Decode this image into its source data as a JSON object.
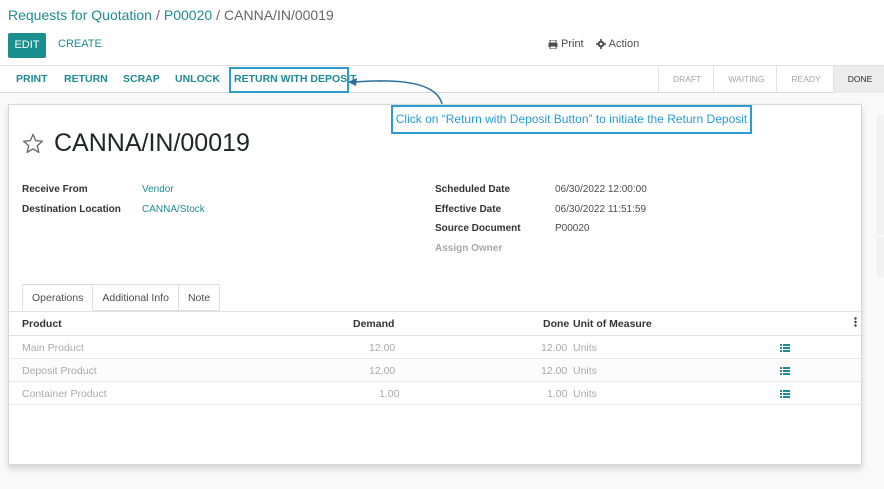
{
  "breadcrumb": {
    "crumb1": "Requests for Quotation",
    "crumb2": "P00020",
    "current": "CANNA/IN/00019",
    "separator": "/"
  },
  "control": {
    "edit_label": "EDIT",
    "create_label": "CREATE",
    "print_label": "Print",
    "action_label": "Action"
  },
  "statusbar": {
    "buttons": [
      "PRINT",
      "RETURN",
      "SCRAP",
      "UNLOCK",
      "RETURN WITH DEPOSIT"
    ],
    "stages": [
      "DRAFT",
      "WAITING",
      "READY",
      "DONE"
    ],
    "active_stage": "DONE"
  },
  "tooltip": {
    "text": "Click on “Return with Deposit Button” to initiate the Return Deposit"
  },
  "record": {
    "title": "CANNA/IN/00019",
    "receive_from_label": "Receive From",
    "receive_from_value": "Vendor",
    "destination_label": "Destination Location",
    "destination_value": "CANNA/Stock",
    "scheduled_label": "Scheduled Date",
    "scheduled_value": "06/30/2022 12:00:00",
    "effective_label": "Effective Date",
    "effective_value": "06/30/2022 11:51:59",
    "source_label": "Source Document",
    "source_value": "P00020",
    "assign_owner_label": "Assign Owner"
  },
  "tabs": [
    "Operations",
    "Additional Info",
    "Note"
  ],
  "table": {
    "headers": [
      "Product",
      "Demand",
      "Done",
      "Unit of Measure"
    ],
    "rows": [
      {
        "product": "Main Product",
        "demand": "12.00",
        "done": "12.00",
        "uom": "Units"
      },
      {
        "product": "Deposit Product",
        "demand": "12.00",
        "done": "12.00",
        "uom": "Units"
      },
      {
        "product": "Container Product",
        "demand": "1.00",
        "done": "1.00",
        "uom": "Units"
      }
    ]
  },
  "colors": {
    "brand": "#1b8e8e",
    "link": "#1f8b94",
    "annotation": "#2b9bd4"
  }
}
